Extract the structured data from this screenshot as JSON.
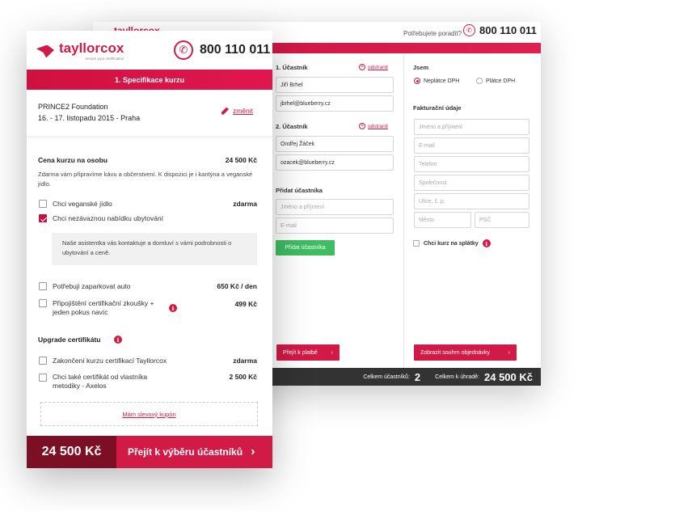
{
  "back": {
    "logo": "tayllorcox",
    "help_text": "Potřebujete poradit?",
    "phone": "800 110 011",
    "participant1_label": "1. Účastník",
    "participant1_name": "Jiří Brhel",
    "participant1_email": "jbrhel@blueberry.cz",
    "participant2_label": "2. Účastník",
    "participant2_name": "Ondřej Žáček",
    "participant2_email": "ozacek@blueberry.cz",
    "remove_label": "odstranit",
    "add_participant_label": "Přidat účastníka",
    "name_placeholder": "Jméno a příjmení",
    "email_placeholder": "E-mail",
    "add_participant_button": "Přidat účastníka",
    "to_payment_button": "Přejít k platbě",
    "i_am_label": "Jsem",
    "radio_non_vat": "Neplátce DPH",
    "radio_vat": "Plátce DPH",
    "billing_label": "Fakturační údaje",
    "billing_placeholders": {
      "name": "Jméno a příjmení",
      "email": "E-mail",
      "phone": "Telefon",
      "company": "Společnost",
      "street": "Ulice, č. p.",
      "city": "Město",
      "zip": "PSČ"
    },
    "installments_label": "Chci kurz na splátky",
    "summary_button": "Zobrazit souhrn objednávky",
    "total_participants_label": "Celkem účastníků:",
    "total_participants": "2",
    "total_pay_label": "Celkem k úhradě:",
    "total_pay": "24 500 Kč"
  },
  "front": {
    "logo": "tayllorcox",
    "logo_tagline": "ensure your certification",
    "phone": "800 110 011",
    "step_title": "1. Specifikace kurzu",
    "course_name": "PRINCE2 Foundation",
    "course_date": "16. - 17. listopadu 2015 - Praha",
    "change_label": "změnit",
    "price_label": "Cena kurzu na osobu",
    "price_value": "24 500 Kč",
    "price_note": "Zdarma vám připravíme kávu a občerstvení. K dispozici je i kantýna a veganské jídlo.",
    "vegan_label": "Chci veganské jídlo",
    "vegan_value": "zdarma",
    "accommodation_label": "Chci nezávaznou nabídku ubytování",
    "accommodation_note": "Naše asistentka vás kontaktuje a domluví s vámi podrobnosti o ubytování a ceně.",
    "parking_label": "Potřebuji zaparkovat auto",
    "parking_value": "650 Kč / den",
    "insurance_label": "Připojištění certifikační zkoušky + jeden pokus navíc",
    "insurance_value": "499 Kč",
    "upgrade_label": "Upgrade certifikátu",
    "cert_tayllorcox_label": "Zakončení kurzu certifikací Tayllorcox",
    "cert_tayllorcox_value": "zdarma",
    "cert_axelos_label": "Chci také certifikát od vlastníka metodiky - Axelos",
    "cert_axelos_value": "2 500 Kč",
    "coupon_label": "Mám slevový kupón",
    "total_price": "24 500 Kč",
    "continue_button": "Přejít k výběru účastníků"
  },
  "icons": {
    "phone": "phone-icon",
    "info": "info-icon",
    "remove": "close-circle-icon",
    "arrow": "chevron-right-icon"
  },
  "colors": {
    "brand": "#d11a45",
    "dark_brand": "#7c0f24",
    "green": "#3ebd63",
    "bar": "#333333"
  }
}
